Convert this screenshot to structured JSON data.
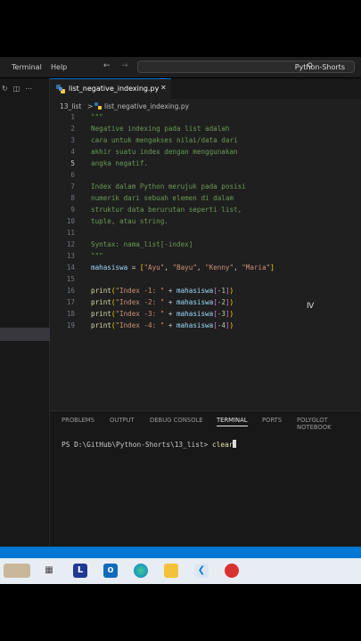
{
  "menu": {
    "terminal": "Terminal",
    "help": "Help"
  },
  "search": {
    "text": "Python-Shorts"
  },
  "tab": {
    "label": "list_negative_indexing.py",
    "close": "✕"
  },
  "breadcrumb": {
    "folder": "13_list",
    "separator": ">",
    "file": "list_negative_indexing.py"
  },
  "editor": {
    "active_line": 5,
    "lines": [
      {
        "n": "1",
        "tokens": [
          [
            "c-comment",
            "\"\"\""
          ]
        ]
      },
      {
        "n": "2",
        "tokens": [
          [
            "c-comment",
            "Negative indexing pada list adalah"
          ]
        ]
      },
      {
        "n": "3",
        "tokens": [
          [
            "c-comment",
            "cara untuk mengakses nilai/data dari"
          ]
        ]
      },
      {
        "n": "4",
        "tokens": [
          [
            "c-comment",
            "akhir suatu index dengan menggunakan"
          ]
        ]
      },
      {
        "n": "5",
        "tokens": [
          [
            "c-comment",
            "angka negatif."
          ]
        ]
      },
      {
        "n": "6",
        "tokens": []
      },
      {
        "n": "7",
        "tokens": [
          [
            "c-comment",
            "Index dalam Python merujuk pada posisi"
          ]
        ]
      },
      {
        "n": "8",
        "tokens": [
          [
            "c-comment",
            "numerik dari sebuah elemen di dalam"
          ]
        ]
      },
      {
        "n": "9",
        "tokens": [
          [
            "c-comment",
            "struktur data berurutan seperti list,"
          ]
        ]
      },
      {
        "n": "10",
        "tokens": [
          [
            "c-comment",
            "tuple, atau string."
          ]
        ]
      },
      {
        "n": "11",
        "tokens": []
      },
      {
        "n": "12",
        "tokens": [
          [
            "c-comment",
            "Syntax: nama_list[-index]"
          ]
        ]
      },
      {
        "n": "13",
        "tokens": [
          [
            "c-comment",
            "\"\"\""
          ]
        ]
      },
      {
        "n": "14",
        "tokens": [
          [
            "c-var",
            "mahasiswa"
          ],
          [
            "c-op",
            " = "
          ],
          [
            "c-br",
            "["
          ],
          [
            "c-str",
            "\"Ayu\""
          ],
          [
            "c-op",
            ", "
          ],
          [
            "c-str",
            "\"Bayu\""
          ],
          [
            "c-op",
            ", "
          ],
          [
            "c-str",
            "\"Kenny\""
          ],
          [
            "c-op",
            ", "
          ],
          [
            "c-str",
            "\"Maria\""
          ],
          [
            "c-br",
            "]"
          ]
        ]
      },
      {
        "n": "15",
        "tokens": []
      },
      {
        "n": "16",
        "tokens": [
          [
            "c-fn",
            "print"
          ],
          [
            "c-br",
            "("
          ],
          [
            "c-str",
            "\"Index -1: \""
          ],
          [
            "c-op",
            " + "
          ],
          [
            "c-var",
            "mahasiswa"
          ],
          [
            "c-br2",
            "["
          ],
          [
            "c-num",
            "-1"
          ],
          [
            "c-br2",
            "]"
          ],
          [
            "c-br",
            ")"
          ]
        ]
      },
      {
        "n": "17",
        "tokens": [
          [
            "c-fn",
            "print"
          ],
          [
            "c-br",
            "("
          ],
          [
            "c-str",
            "\"Index -2: \""
          ],
          [
            "c-op",
            " + "
          ],
          [
            "c-var",
            "mahasiswa"
          ],
          [
            "c-br2",
            "["
          ],
          [
            "c-num",
            "-2"
          ],
          [
            "c-br2",
            "]"
          ],
          [
            "c-br",
            ")"
          ]
        ]
      },
      {
        "n": "18",
        "tokens": [
          [
            "c-fn",
            "print"
          ],
          [
            "c-br",
            "("
          ],
          [
            "c-str",
            "\"Index -3: \""
          ],
          [
            "c-op",
            " + "
          ],
          [
            "c-var",
            "mahasiswa"
          ],
          [
            "c-br2",
            "["
          ],
          [
            "c-num",
            "-3"
          ],
          [
            "c-br2",
            "]"
          ],
          [
            "c-br",
            ")"
          ]
        ]
      },
      {
        "n": "19",
        "tokens": [
          [
            "c-fn",
            "print"
          ],
          [
            "c-br",
            "("
          ],
          [
            "c-str",
            "\"Index -4: \""
          ],
          [
            "c-op",
            " + "
          ],
          [
            "c-var",
            "mahasiswa"
          ],
          [
            "c-br2",
            "["
          ],
          [
            "c-num",
            "-4"
          ],
          [
            "c-br2",
            "]"
          ],
          [
            "c-br",
            ")"
          ]
        ]
      }
    ]
  },
  "panel": {
    "tabs": [
      "PROBLEMS",
      "OUTPUT",
      "DEBUG CONSOLE",
      "TERMINAL",
      "PORTS",
      "POLYGLOT NOTEBOOK"
    ],
    "active_tab": "TERMINAL",
    "terminal_prompt": "PS D:\\GitHub\\Python-Shorts\\13_list> ",
    "terminal_command": "clear"
  },
  "taskbar": {
    "apps": [
      "landmark-icon",
      "task-view-icon",
      "linkedin-learning-icon",
      "outlook-icon",
      "edge-icon",
      "file-explorer-icon",
      "vscode-icon",
      "ladybug-app-icon"
    ]
  },
  "colors": {
    "accent": "#0078d4",
    "comment": "#6a9955",
    "string": "#ce9178"
  }
}
